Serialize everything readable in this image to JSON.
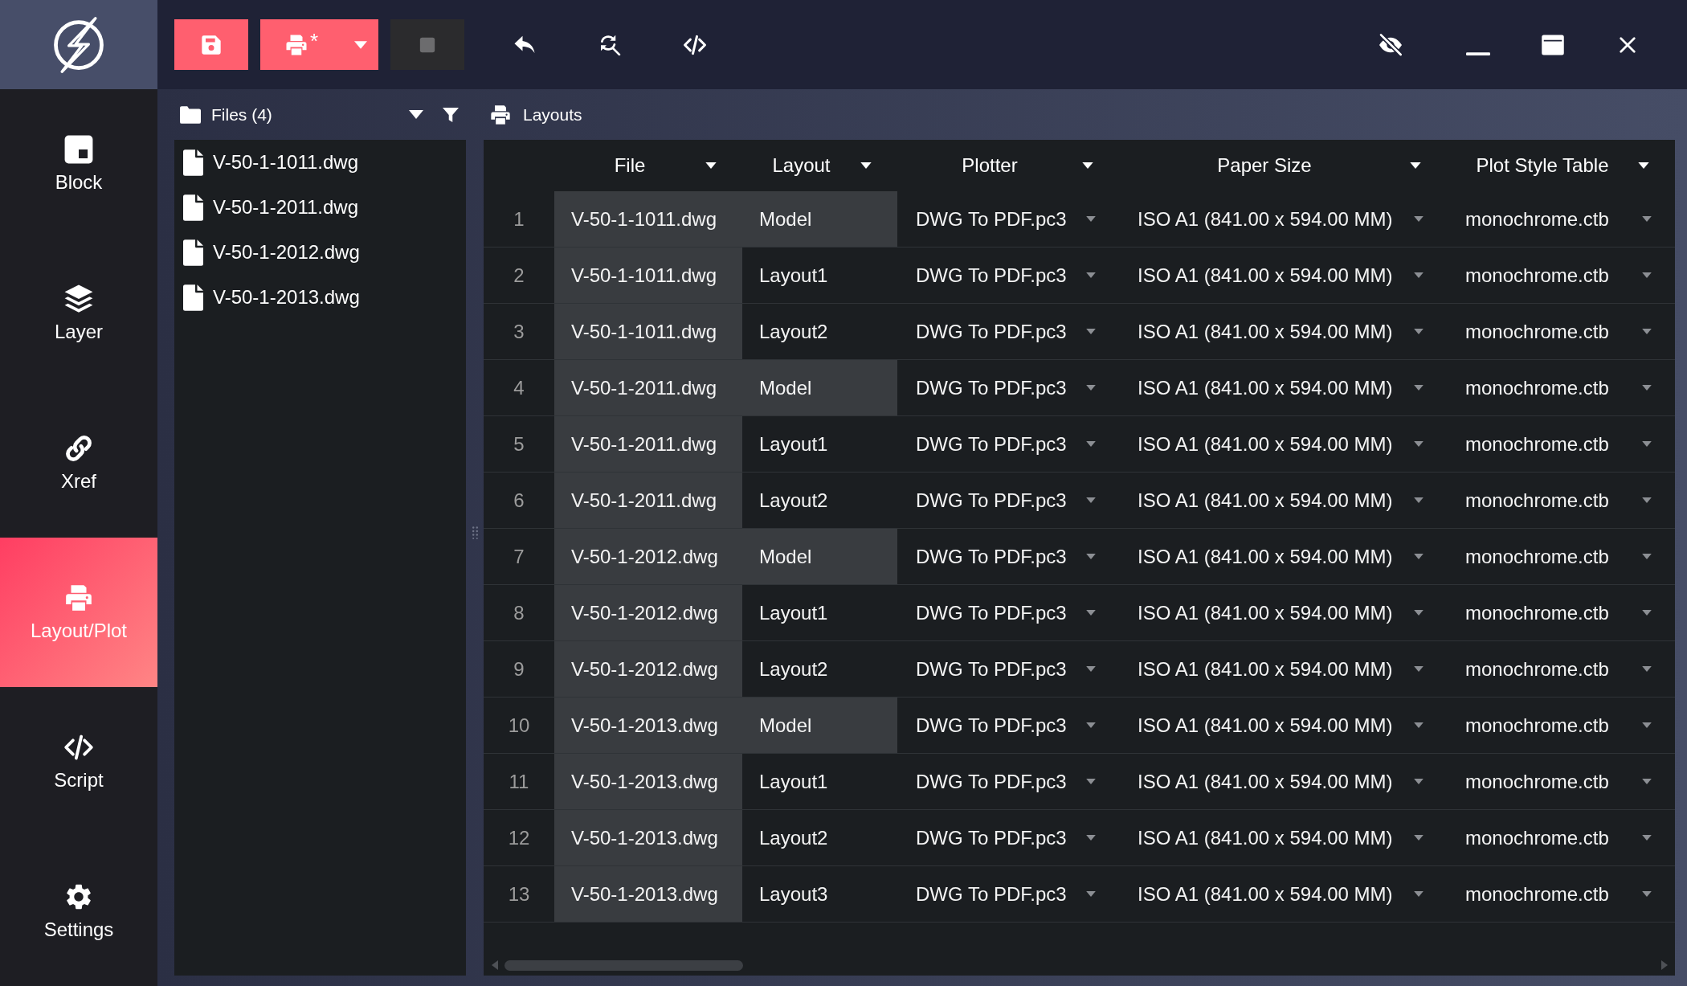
{
  "sidebar": {
    "items": [
      {
        "label": "Block",
        "selected": false
      },
      {
        "label": "Layer",
        "selected": false
      },
      {
        "label": "Xref",
        "selected": false
      },
      {
        "label": "Layout/Plot",
        "selected": true
      },
      {
        "label": "Script",
        "selected": false
      },
      {
        "label": "Settings",
        "selected": false
      }
    ]
  },
  "toolbar": {
    "print_button": {
      "marker": "*"
    },
    "stop_button": {
      "disabled": true
    }
  },
  "files_panel": {
    "title": "Files (4)",
    "files": [
      "V-50-1-1011.dwg",
      "V-50-1-2011.dwg",
      "V-50-1-2012.dwg",
      "V-50-1-2013.dwg"
    ]
  },
  "layouts_panel": {
    "title": "Layouts",
    "table": {
      "columns": [
        "File",
        "Layout",
        "Plotter",
        "Paper Size",
        "Plot Style Table"
      ],
      "rows": [
        {
          "number": "1",
          "file": "V-50-1-1011.dwg",
          "layout": "Model",
          "layout_highlighted": true,
          "plotter": "DWG To PDF.pc3",
          "paper_size": "ISO A1 (841.00 x 594.00 MM)",
          "plot_style_table": "monochrome.ctb"
        },
        {
          "number": "2",
          "file": "V-50-1-1011.dwg",
          "layout": "Layout1",
          "layout_highlighted": false,
          "plotter": "DWG To PDF.pc3",
          "paper_size": "ISO A1 (841.00 x 594.00 MM)",
          "plot_style_table": "monochrome.ctb"
        },
        {
          "number": "3",
          "file": "V-50-1-1011.dwg",
          "layout": "Layout2",
          "layout_highlighted": false,
          "plotter": "DWG To PDF.pc3",
          "paper_size": "ISO A1 (841.00 x 594.00 MM)",
          "plot_style_table": "monochrome.ctb"
        },
        {
          "number": "4",
          "file": "V-50-1-2011.dwg",
          "layout": "Model",
          "layout_highlighted": true,
          "plotter": "DWG To PDF.pc3",
          "paper_size": "ISO A1 (841.00 x 594.00 MM)",
          "plot_style_table": "monochrome.ctb"
        },
        {
          "number": "5",
          "file": "V-50-1-2011.dwg",
          "layout": "Layout1",
          "layout_highlighted": false,
          "plotter": "DWG To PDF.pc3",
          "paper_size": "ISO A1 (841.00 x 594.00 MM)",
          "plot_style_table": "monochrome.ctb"
        },
        {
          "number": "6",
          "file": "V-50-1-2011.dwg",
          "layout": "Layout2",
          "layout_highlighted": false,
          "plotter": "DWG To PDF.pc3",
          "paper_size": "ISO A1 (841.00 x 594.00 MM)",
          "plot_style_table": "monochrome.ctb"
        },
        {
          "number": "7",
          "file": "V-50-1-2012.dwg",
          "layout": "Model",
          "layout_highlighted": true,
          "plotter": "DWG To PDF.pc3",
          "paper_size": "ISO A1 (841.00 x 594.00 MM)",
          "plot_style_table": "monochrome.ctb"
        },
        {
          "number": "8",
          "file": "V-50-1-2012.dwg",
          "layout": "Layout1",
          "layout_highlighted": false,
          "plotter": "DWG To PDF.pc3",
          "paper_size": "ISO A1 (841.00 x 594.00 MM)",
          "plot_style_table": "monochrome.ctb"
        },
        {
          "number": "9",
          "file": "V-50-1-2012.dwg",
          "layout": "Layout2",
          "layout_highlighted": false,
          "plotter": "DWG To PDF.pc3",
          "paper_size": "ISO A1 (841.00 x 594.00 MM)",
          "plot_style_table": "monochrome.ctb"
        },
        {
          "number": "10",
          "file": "V-50-1-2013.dwg",
          "layout": "Model",
          "layout_highlighted": true,
          "plotter": "DWG To PDF.pc3",
          "paper_size": "ISO A1 (841.00 x 594.00 MM)",
          "plot_style_table": "monochrome.ctb"
        },
        {
          "number": "11",
          "file": "V-50-1-2013.dwg",
          "layout": "Layout1",
          "layout_highlighted": false,
          "plotter": "DWG To PDF.pc3",
          "paper_size": "ISO A1 (841.00 x 594.00 MM)",
          "plot_style_table": "monochrome.ctb"
        },
        {
          "number": "12",
          "file": "V-50-1-2013.dwg",
          "layout": "Layout2",
          "layout_highlighted": false,
          "plotter": "DWG To PDF.pc3",
          "paper_size": "ISO A1 (841.00 x 594.00 MM)",
          "plot_style_table": "monochrome.ctb"
        },
        {
          "number": "13",
          "file": "V-50-1-2013.dwg",
          "layout": "Layout3",
          "layout_highlighted": false,
          "plotter": "DWG To PDF.pc3",
          "paper_size": "ISO A1 (841.00 x 594.00 MM)",
          "plot_style_table": "monochrome.ctb"
        }
      ]
    }
  }
}
